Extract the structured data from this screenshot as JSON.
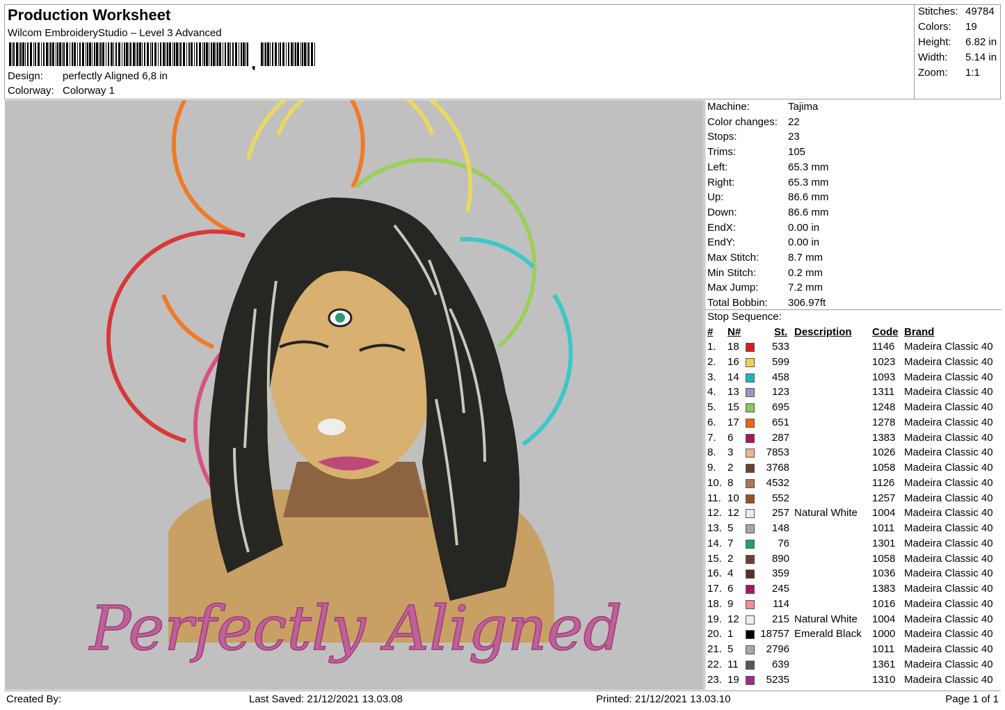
{
  "header": {
    "title": "Production Worksheet",
    "software": "Wilcom EmbroideryStudio – Level 3 Advanced",
    "design_label": "Design:",
    "design_value": "perfectly Aligned 6,8 in",
    "colorway_label": "Colorway:",
    "colorway_value": "Colorway 1"
  },
  "stats": [
    {
      "label": "Stitches:",
      "value": "49784"
    },
    {
      "label": "Colors:",
      "value": "19"
    },
    {
      "label": "Height:",
      "value": "6.82 in"
    },
    {
      "label": "Width:",
      "value": "5.14 in"
    },
    {
      "label": "Zoom:",
      "value": "1:1"
    }
  ],
  "preview": {
    "caption_text": "Perfectly Aligned",
    "ring_colors": [
      "#e8d860",
      "#f07a28",
      "#9ccf5a",
      "#d83838",
      "#3cc8c8",
      "#d85088"
    ]
  },
  "machine_info": [
    {
      "label": "Machine:",
      "value": "Tajima"
    },
    {
      "label": "Color changes:",
      "value": "22"
    },
    {
      "label": "Stops:",
      "value": "23"
    },
    {
      "label": "Trims:",
      "value": "105"
    },
    {
      "label": "Left:",
      "value": "65.3 mm"
    },
    {
      "label": "Right:",
      "value": "65.3 mm"
    },
    {
      "label": "Up:",
      "value": "86.6 mm"
    },
    {
      "label": "Down:",
      "value": "86.6 mm"
    },
    {
      "label": "EndX:",
      "value": "0.00 in"
    },
    {
      "label": "EndY:",
      "value": "0.00 in"
    },
    {
      "label": "Max Stitch:",
      "value": "8.7 mm"
    },
    {
      "label": "Min Stitch:",
      "value": "0.2 mm"
    },
    {
      "label": "Max Jump:",
      "value": "7.2 mm"
    },
    {
      "label": "Total Bobbin:",
      "value": "306.97ft"
    }
  ],
  "stop_sequence": {
    "title": "Stop Sequence:",
    "headers": {
      "idx": "#",
      "needle": "N#",
      "stitches": "St.",
      "description": "Description",
      "code": "Code",
      "brand": "Brand"
    },
    "rows": [
      {
        "idx": "1.",
        "needle": "18",
        "color": "#d42020",
        "stitches": "533",
        "description": "",
        "code": "1146",
        "brand": "Madeira Classic 40"
      },
      {
        "idx": "2.",
        "needle": "16",
        "color": "#ecd25c",
        "stitches": "599",
        "description": "",
        "code": "1023",
        "brand": "Madeira Classic 40"
      },
      {
        "idx": "3.",
        "needle": "14",
        "color": "#22b4bc",
        "stitches": "458",
        "description": "",
        "code": "1093",
        "brand": "Madeira Classic 40"
      },
      {
        "idx": "4.",
        "needle": "13",
        "color": "#9a96c4",
        "stitches": "123",
        "description": "",
        "code": "1311",
        "brand": "Madeira Classic 40"
      },
      {
        "idx": "5.",
        "needle": "15",
        "color": "#8cc85a",
        "stitches": "695",
        "description": "",
        "code": "1248",
        "brand": "Madeira Classic 40"
      },
      {
        "idx": "6.",
        "needle": "17",
        "color": "#f06418",
        "stitches": "651",
        "description": "",
        "code": "1278",
        "brand": "Madeira Classic 40"
      },
      {
        "idx": "7.",
        "needle": "6",
        "color": "#a8185c",
        "stitches": "287",
        "description": "",
        "code": "1383",
        "brand": "Madeira Classic 40"
      },
      {
        "idx": "8.",
        "needle": "3",
        "color": "#f0b48c",
        "stitches": "7853",
        "description": "",
        "code": "1026",
        "brand": "Madeira Classic 40"
      },
      {
        "idx": "9.",
        "needle": "2",
        "color": "#6c4030",
        "stitches": "3768",
        "description": "",
        "code": "1058",
        "brand": "Madeira Classic 40"
      },
      {
        "idx": "10.",
        "needle": "8",
        "color": "#b07850",
        "stitches": "4532",
        "description": "",
        "code": "1126",
        "brand": "Madeira Classic 40"
      },
      {
        "idx": "11.",
        "needle": "10",
        "color": "#a05028",
        "stitches": "552",
        "description": "",
        "code": "1257",
        "brand": "Madeira Classic 40"
      },
      {
        "idx": "12.",
        "needle": "12",
        "color": "#ececf4",
        "stitches": "257",
        "description": "Natural White",
        "code": "1004",
        "brand": "Madeira Classic 40"
      },
      {
        "idx": "13.",
        "needle": "5",
        "color": "#a8a8ac",
        "stitches": "148",
        "description": "",
        "code": "1011",
        "brand": "Madeira Classic 40"
      },
      {
        "idx": "14.",
        "needle": "7",
        "color": "#24a070",
        "stitches": "76",
        "description": "",
        "code": "1301",
        "brand": "Madeira Classic 40"
      },
      {
        "idx": "15.",
        "needle": "2",
        "color": "#6c4030",
        "stitches": "890",
        "description": "",
        "code": "1058",
        "brand": "Madeira Classic 40"
      },
      {
        "idx": "16.",
        "needle": "4",
        "color": "#5c2c28",
        "stitches": "359",
        "description": "",
        "code": "1036",
        "brand": "Madeira Classic 40"
      },
      {
        "idx": "17.",
        "needle": "6",
        "color": "#a8185c",
        "stitches": "245",
        "description": "",
        "code": "1383",
        "brand": "Madeira Classic 40"
      },
      {
        "idx": "18.",
        "needle": "9",
        "color": "#f08c94",
        "stitches": "114",
        "description": "",
        "code": "1016",
        "brand": "Madeira Classic 40"
      },
      {
        "idx": "19.",
        "needle": "12",
        "color": "#ececf4",
        "stitches": "215",
        "description": "Natural White",
        "code": "1004",
        "brand": "Madeira Classic 40"
      },
      {
        "idx": "20.",
        "needle": "1",
        "color": "#000000",
        "stitches": "18757",
        "description": "Emerald Black",
        "code": "1000",
        "brand": "Madeira Classic 40"
      },
      {
        "idx": "21.",
        "needle": "5",
        "color": "#a8a8ac",
        "stitches": "2796",
        "description": "",
        "code": "1011",
        "brand": "Madeira Classic 40"
      },
      {
        "idx": "22.",
        "needle": "11",
        "color": "#585858",
        "stitches": "639",
        "description": "",
        "code": "1361",
        "brand": "Madeira Classic 40"
      },
      {
        "idx": "23.",
        "needle": "19",
        "color": "#a02c80",
        "stitches": "5235",
        "description": "",
        "code": "1310",
        "brand": "Madeira Classic 40"
      }
    ]
  },
  "footer": {
    "created_by": "Created By:",
    "last_saved": "Last Saved: 21/12/2021 13.03.08",
    "printed": "Printed: 21/12/2021 13.03.10",
    "page": "Page 1 of 1"
  }
}
